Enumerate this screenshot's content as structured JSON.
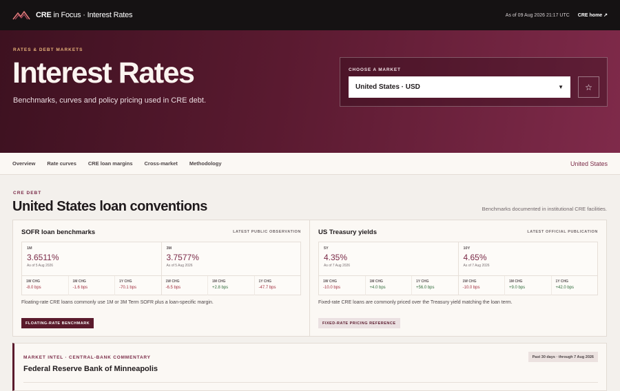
{
  "topbar": {
    "brand_bold": "CRE",
    "brand_rest": " in Focus · Interest Rates",
    "as_of": "As of 09 Aug 2026 21:17 UTC",
    "home_link": "CRE home ↗"
  },
  "hero": {
    "eyebrow": "RATES & DEBT MARKETS",
    "title": "Interest Rates",
    "subtitle": "Benchmarks, curves and policy pricing used in CRE debt.",
    "market_label": "CHOOSE A MARKET",
    "market_value": "United States · USD"
  },
  "subnav": {
    "items": [
      "Overview",
      "Rate curves",
      "CRE loan margins",
      "Cross-market",
      "Methodology"
    ],
    "country": "United States"
  },
  "section": {
    "eyebrow": "CRE DEBT",
    "title": "United States loan conventions",
    "note": "Benchmarks documented in institutional CRE facilities."
  },
  "sofr": {
    "title": "SOFR loan benchmarks",
    "tag": "LATEST PUBLIC OBSERVATION",
    "quotes": [
      {
        "tenor": "1M",
        "value": "3.6511%",
        "as_of": "As of 5 Aug 2026",
        "changes": [
          {
            "label": "1W CHG",
            "value": "-8.0 bps"
          },
          {
            "label": "1M CHG",
            "value": "-1.6 bps"
          },
          {
            "label": "1Y CHG",
            "value": "-70.1 bps"
          }
        ]
      },
      {
        "tenor": "3M",
        "value": "3.7577%",
        "as_of": "As of 5 Aug 2026",
        "changes": [
          {
            "label": "1W CHG",
            "value": "-6.5 bps"
          },
          {
            "label": "1M CHG",
            "value": "+2.8 bps"
          },
          {
            "label": "1Y CHG",
            "value": "-47.7 bps"
          }
        ]
      }
    ],
    "description": "Floating-rate CRE loans commonly use 1M or 3M Term SOFR plus a loan-specific margin.",
    "badge": "FLOATING-RATE BENCHMARK"
  },
  "treasury": {
    "title": "US Treasury yields",
    "tag": "LATEST OFFICIAL PUBLICATION",
    "quotes": [
      {
        "tenor": "5Y",
        "value": "4.35%",
        "as_of": "As of 7 Aug 2026",
        "changes": [
          {
            "label": "1W CHG",
            "value": "-10.0 bps"
          },
          {
            "label": "1M CHG",
            "value": "+4.0 bps"
          },
          {
            "label": "1Y CHG",
            "value": "+56.0 bps"
          }
        ]
      },
      {
        "tenor": "10Y",
        "value": "4.65%",
        "as_of": "As of 7 Aug 2026",
        "changes": [
          {
            "label": "1W CHG",
            "value": "-10.0 bps"
          },
          {
            "label": "1M CHG",
            "value": "+9.0 bps"
          },
          {
            "label": "1Y CHG",
            "value": "+42.0 bps"
          }
        ]
      }
    ],
    "description": "Fixed-rate CRE loans are commonly priced over the Treasury yield matching the loan term.",
    "badge": "FIXED-RATE PRICING REFERENCE"
  },
  "intel": {
    "eyebrow": "MARKET INTEL · CENTRAL-BANK COMMENTARY",
    "title": "Federal Reserve Bank of Minneapolis",
    "period": "Past 30 days · through 7 Aug 2026"
  },
  "colors": {
    "accent": "#7a2a47",
    "hero_dark": "#3d1120",
    "negative": "#a12d3e",
    "positive": "#2f6b3a"
  }
}
